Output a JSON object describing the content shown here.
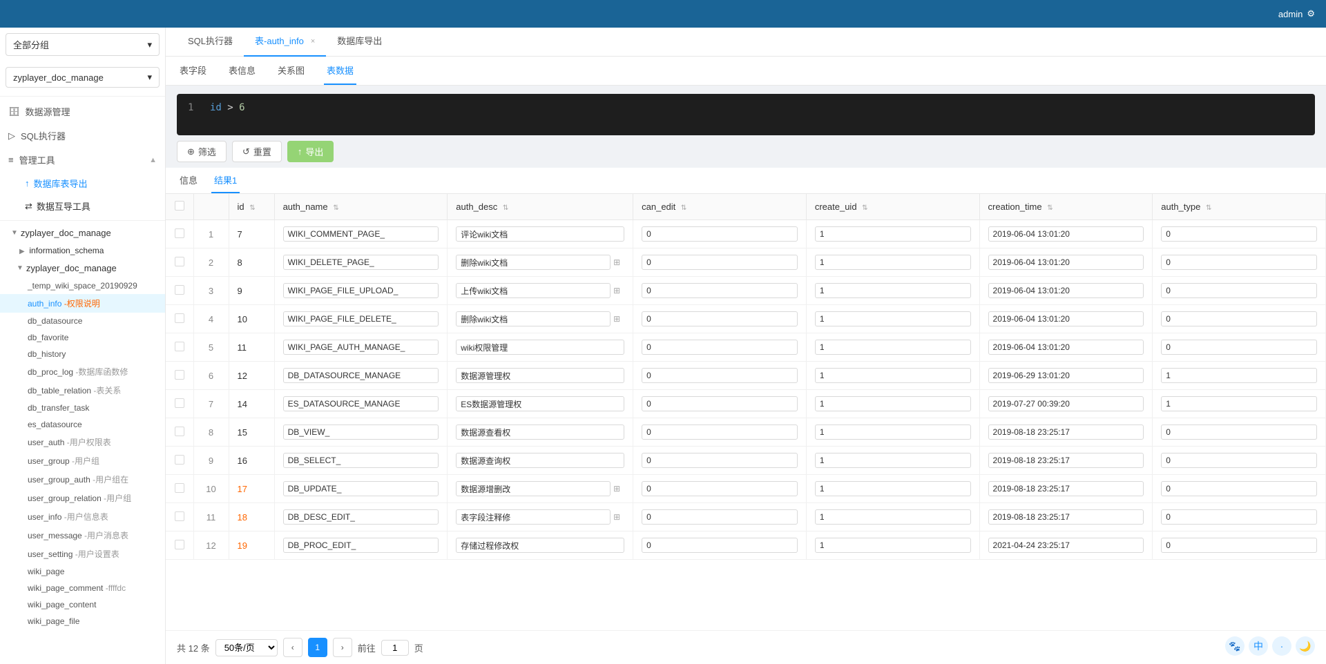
{
  "header": {
    "admin_label": "admin",
    "settings_icon": "⚙"
  },
  "sidebar": {
    "group_select": "全部分组",
    "db_select": "zyplayer_doc_manage",
    "sections": [
      {
        "id": "datasource",
        "icon": "🗄",
        "label": "数据源管理"
      },
      {
        "id": "sql",
        "icon": "▶",
        "label": "SQL执行器"
      },
      {
        "id": "tools",
        "icon": "≡",
        "label": "管理工具",
        "expanded": true
      },
      {
        "id": "db-export",
        "icon": "↑",
        "label": "数据库表导出",
        "indent": true
      },
      {
        "id": "data-transfer",
        "icon": "⇄",
        "label": "数据互导工具",
        "indent": true
      }
    ],
    "tree": {
      "root1": {
        "label": "zyplayer_doc_manage",
        "expanded": true,
        "children": [
          {
            "label": "information_schema",
            "expanded": false,
            "children": []
          },
          {
            "label": "zyplayer_doc_manage",
            "expanded": true,
            "children": [
              {
                "label": "_temp_wiki_space_20190929",
                "suffix": ""
              },
              {
                "label": "auth_info",
                "suffix": " -权限说明",
                "selected": true
              },
              {
                "label": "db_datasource",
                "suffix": ""
              },
              {
                "label": "db_favorite",
                "suffix": ""
              },
              {
                "label": "db_history",
                "suffix": ""
              },
              {
                "label": "db_proc_log",
                "suffix": " -数据库函数修"
              },
              {
                "label": "db_table_relation",
                "suffix": " -表关系"
              },
              {
                "label": "db_transfer_task",
                "suffix": ""
              },
              {
                "label": "es_datasource",
                "suffix": ""
              },
              {
                "label": "user_auth",
                "suffix": " -用户权限表"
              },
              {
                "label": "user_group",
                "suffix": " -用户组"
              },
              {
                "label": "user_group_auth",
                "suffix": " -用户组在"
              },
              {
                "label": "user_group_relation",
                "suffix": " -用户组"
              },
              {
                "label": "user_info",
                "suffix": " -用户信息表"
              },
              {
                "label": "user_message",
                "suffix": " -用户消息表"
              },
              {
                "label": "user_setting",
                "suffix": " -用户设置表"
              },
              {
                "label": "wiki_page",
                "suffix": ""
              },
              {
                "label": "wiki_page_comment",
                "suffix": " -ffffdc"
              },
              {
                "label": "wiki_page_content",
                "suffix": ""
              },
              {
                "label": "wiki_page_file",
                "suffix": ""
              }
            ]
          }
        ]
      }
    }
  },
  "tabs": [
    {
      "id": "sql-executor",
      "label": "SQL执行器",
      "closeable": false,
      "active": false
    },
    {
      "id": "auth-info",
      "label": "表-auth_info",
      "closeable": true,
      "active": true
    },
    {
      "id": "db-export",
      "label": "数据库导出",
      "closeable": false,
      "active": false
    }
  ],
  "sub_tabs": [
    {
      "id": "fields",
      "label": "表字段"
    },
    {
      "id": "info",
      "label": "表信息"
    },
    {
      "id": "relation",
      "label": "关系图"
    },
    {
      "id": "data",
      "label": "表数据",
      "active": true
    }
  ],
  "sql_editor": {
    "line_num": "1",
    "content": "id > 6"
  },
  "toolbar": {
    "filter_label": "筛选",
    "reset_label": "重置",
    "export_label": "导出"
  },
  "result_tabs": [
    {
      "id": "info",
      "label": "信息"
    },
    {
      "id": "result1",
      "label": "结果1",
      "active": true
    }
  ],
  "table": {
    "columns": [
      {
        "id": "checkbox",
        "label": ""
      },
      {
        "id": "rownum",
        "label": ""
      },
      {
        "id": "id",
        "label": "id",
        "sortable": true
      },
      {
        "id": "auth_name",
        "label": "auth_name",
        "sortable": true
      },
      {
        "id": "auth_desc",
        "label": "auth_desc",
        "sortable": true
      },
      {
        "id": "can_edit",
        "label": "can_edit",
        "sortable": true
      },
      {
        "id": "create_uid",
        "label": "create_uid",
        "sortable": true
      },
      {
        "id": "creation_time",
        "label": "creation_time",
        "sortable": true
      },
      {
        "id": "auth_type",
        "label": "auth_type",
        "sortable": true
      }
    ],
    "rows": [
      {
        "rownum": "1",
        "id": "7",
        "auth_name": "WIKI_COMMENT_PAGE_",
        "auth_desc": "评论wiki文档",
        "can_edit": "0",
        "create_uid": "1",
        "creation_time": "2019-06-04 13:01:20",
        "auth_type": "0",
        "id_orange": false
      },
      {
        "rownum": "2",
        "id": "8",
        "auth_name": "WIKI_DELETE_PAGE_",
        "auth_desc": "删除wiki文档",
        "can_edit": "0",
        "create_uid": "1",
        "creation_time": "2019-06-04 13:01:20",
        "auth_type": "0",
        "id_orange": false
      },
      {
        "rownum": "3",
        "id": "9",
        "auth_name": "WIKI_PAGE_FILE_UPLOAD_",
        "auth_desc": "上传wiki文档",
        "can_edit": "0",
        "create_uid": "1",
        "creation_time": "2019-06-04 13:01:20",
        "auth_type": "0",
        "id_orange": false
      },
      {
        "rownum": "4",
        "id": "10",
        "auth_name": "WIKI_PAGE_FILE_DELETE_",
        "auth_desc": "删除wiki文档",
        "can_edit": "0",
        "create_uid": "1",
        "creation_time": "2019-06-04 13:01:20",
        "auth_type": "0",
        "id_orange": false
      },
      {
        "rownum": "5",
        "id": "11",
        "auth_name": "WIKI_PAGE_AUTH_MANAGE_",
        "auth_desc": "wiki权限管理",
        "can_edit": "0",
        "create_uid": "1",
        "creation_time": "2019-06-04 13:01:20",
        "auth_type": "0",
        "id_orange": false
      },
      {
        "rownum": "6",
        "id": "12",
        "auth_name": "DB_DATASOURCE_MANAGE",
        "auth_desc": "数据源管理权",
        "can_edit": "0",
        "create_uid": "1",
        "creation_time": "2019-06-29 13:01:20",
        "auth_type": "1",
        "id_orange": false
      },
      {
        "rownum": "7",
        "id": "14",
        "auth_name": "ES_DATASOURCE_MANAGE",
        "auth_desc": "ES数据源管理权",
        "can_edit": "0",
        "create_uid": "1",
        "creation_time": "2019-07-27 00:39:20",
        "auth_type": "1",
        "id_orange": false
      },
      {
        "rownum": "8",
        "id": "15",
        "auth_name": "DB_VIEW_",
        "auth_desc": "数据源查看权",
        "can_edit": "0",
        "create_uid": "1",
        "creation_time": "2019-08-18 23:25:17",
        "auth_type": "0",
        "id_orange": false
      },
      {
        "rownum": "9",
        "id": "16",
        "auth_name": "DB_SELECT_",
        "auth_desc": "数据源查询权",
        "can_edit": "0",
        "create_uid": "1",
        "creation_time": "2019-08-18 23:25:17",
        "auth_type": "0",
        "id_orange": false
      },
      {
        "rownum": "10",
        "id": "17",
        "auth_name": "DB_UPDATE_",
        "auth_desc": "数据源增删改",
        "can_edit": "0",
        "create_uid": "1",
        "creation_time": "2019-08-18 23:25:17",
        "auth_type": "0",
        "id_orange": true
      },
      {
        "rownum": "11",
        "id": "18",
        "auth_name": "DB_DESC_EDIT_",
        "auth_desc": "表字段注释修",
        "can_edit": "0",
        "create_uid": "1",
        "creation_time": "2019-08-18 23:25:17",
        "auth_type": "0",
        "id_orange": true
      },
      {
        "rownum": "12",
        "id": "19",
        "auth_name": "DB_PROC_EDIT_",
        "auth_desc": "存储过程修改权",
        "can_edit": "0",
        "create_uid": "1",
        "creation_time": "2021-04-24 23:25:17",
        "auth_type": "0",
        "id_orange": true
      }
    ]
  },
  "pagination": {
    "total": "共 12 条",
    "page_size": "50条/页",
    "current_page": "1",
    "page_input": "1",
    "goto_label": "前往",
    "page_unit": "页",
    "prev_arrow": "‹",
    "next_arrow": "›"
  },
  "bottom_toolbar": {
    "icon1": "🐾",
    "icon2": "中",
    "icon3": "·",
    "icon4": "🌙"
  }
}
